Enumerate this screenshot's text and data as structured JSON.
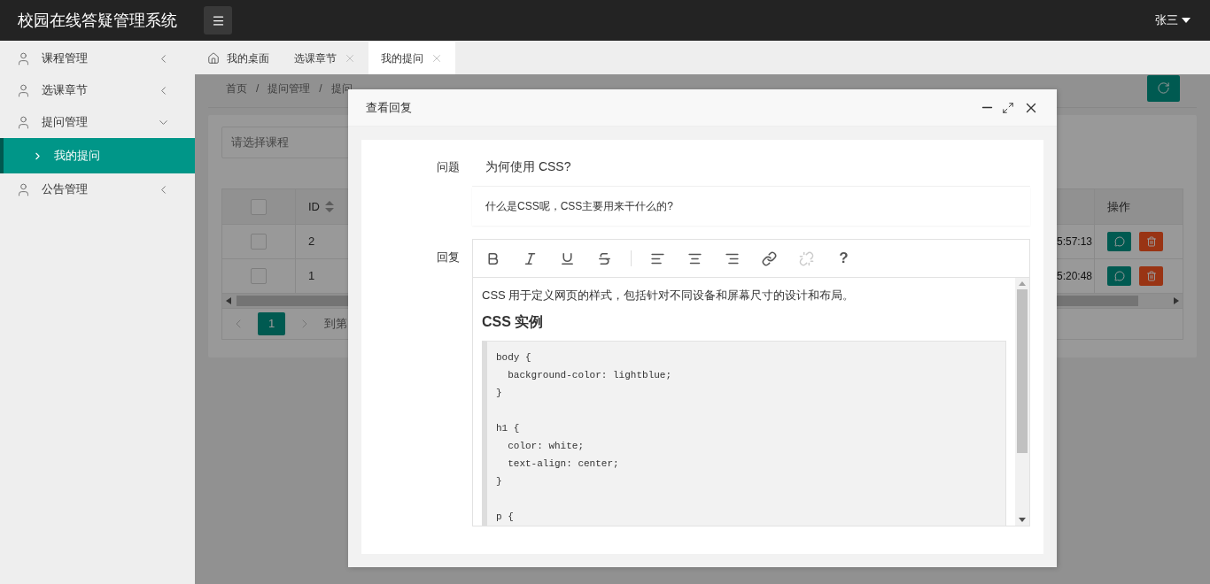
{
  "app_title": "校园在线答疑管理系统",
  "user": {
    "name": "张三"
  },
  "sidebar": {
    "items": [
      {
        "label": "课程管理",
        "expanded": false
      },
      {
        "label": "选课章节",
        "expanded": false
      },
      {
        "label": "提问管理",
        "expanded": true,
        "children": [
          {
            "label": "我的提问",
            "selected": true
          }
        ]
      },
      {
        "label": "公告管理",
        "expanded": false
      }
    ]
  },
  "tabs": [
    {
      "label": "我的桌面",
      "kind": "home",
      "closable": false,
      "selected": false
    },
    {
      "label": "选课章节",
      "kind": "page",
      "closable": true,
      "selected": false
    },
    {
      "label": "我的提问",
      "kind": "page",
      "closable": true,
      "selected": true
    }
  ],
  "breadcrumb": {
    "separator": "/",
    "items": [
      "首页",
      "提问管理",
      "提问"
    ]
  },
  "filter": {
    "placeholder": "请选择课程"
  },
  "table": {
    "header_checked": false,
    "columns": [
      {
        "label": "ID",
        "sortable": true
      },
      {
        "label": "操作",
        "sortable": false
      }
    ],
    "rows": [
      {
        "checked": false,
        "id": "2",
        "column_3": "5:57:13"
      },
      {
        "checked": false,
        "id": "1",
        "column_3": "5:20:48"
      }
    ]
  },
  "pagination": {
    "pages": [
      {
        "label": "1",
        "selected": true
      }
    ],
    "goto_label": "到第"
  },
  "modal": {
    "title": "查看回复",
    "question": {
      "label": "问题",
      "title": "为何使用 CSS?",
      "description": "什么是CSS呢，CSS主要用来干什么的?"
    },
    "reply": {
      "label": "回复",
      "toolbar": [
        {
          "kind": "bold",
          "disabled": false
        },
        {
          "kind": "italic",
          "disabled": false
        },
        {
          "kind": "underline",
          "disabled": false
        },
        {
          "kind": "strike",
          "disabled": false
        },
        {
          "kind": "separator"
        },
        {
          "kind": "align-left",
          "disabled": false
        },
        {
          "kind": "align-center",
          "disabled": false
        },
        {
          "kind": "align-right",
          "disabled": false
        },
        {
          "kind": "link",
          "disabled": false
        },
        {
          "kind": "unlink",
          "disabled": true
        },
        {
          "kind": "help",
          "glyph": "?",
          "disabled": false
        }
      ],
      "paragraph": "CSS 用于定义网页的样式，包括针对不同设备和屏幕尺寸的设计和布局。",
      "heading": "CSS 实例",
      "code": "body {\n  background-color: lightblue;\n}\n\nh1 {\n  color: white;\n  text-align: center;\n}\n\np {"
    }
  }
}
